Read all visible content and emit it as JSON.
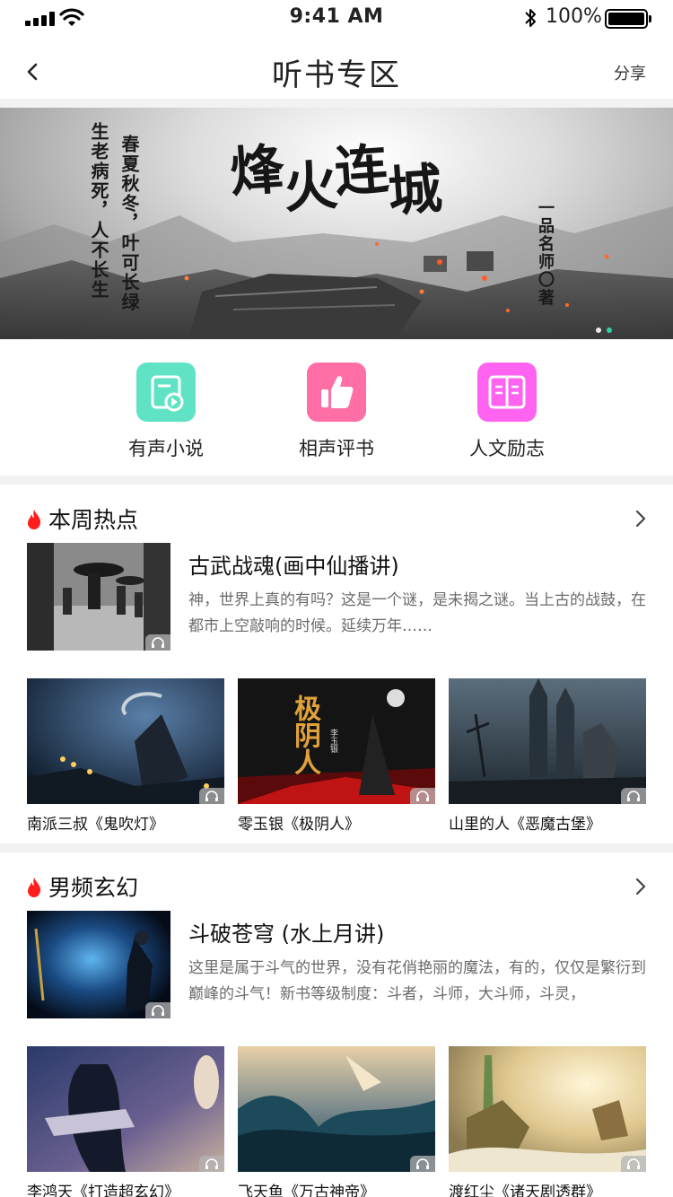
{
  "status_bar": {
    "time": "9:41 AM",
    "battery": "100%"
  },
  "nav": {
    "title": "听书专区",
    "share": "分享"
  },
  "banner": {
    "title_chars": [
      "烽",
      "火",
      "连",
      "城"
    ],
    "poem_line_1": "春夏秋冬，叶可长绿",
    "poem_line_2": "生老病死，人不长生",
    "author": "一品名师〇著",
    "slide_count": 2,
    "active_slide": 2
  },
  "categories": [
    {
      "label": "有声小说",
      "icon": "audio-novel-icon",
      "color": "#5fe3c4"
    },
    {
      "label": "相声评书",
      "icon": "thumbs-up-icon",
      "color": "#ff6fa6"
    },
    {
      "label": "人文励志",
      "icon": "open-book-icon",
      "color": "#ff63f0"
    }
  ],
  "sections": [
    {
      "title": "本周热点",
      "featured": {
        "title": "古武战魂(画中仙播讲)",
        "desc": "神，世界上真的有吗？这是一个谜，是未揭之谜。当上古的战鼓，在都市上空敲响的时候。延续万年……"
      },
      "cards": [
        {
          "caption": "南派三叔《鬼吹灯》"
        },
        {
          "caption": "零玉银《极阴人》",
          "cover_text": "极阴人",
          "cover_author": "李玉银"
        },
        {
          "caption": "山里的人《恶魔古堡》"
        }
      ]
    },
    {
      "title": "男频玄幻",
      "featured": {
        "title": "斗破苍穹 (水上月讲)",
        "desc": "这里是属于斗气的世界，没有花俏艳丽的魔法，有的，仅仅是繁衍到巅峰的斗气！新书等级制度：斗者，斗师，大斗师，斗灵，"
      },
      "cards": [
        {
          "caption": "李鸿天《打造超玄幻》"
        },
        {
          "caption": "飞天鱼《万古神帝》"
        },
        {
          "caption": "渡红尘《诸天剧透群》"
        }
      ]
    }
  ]
}
